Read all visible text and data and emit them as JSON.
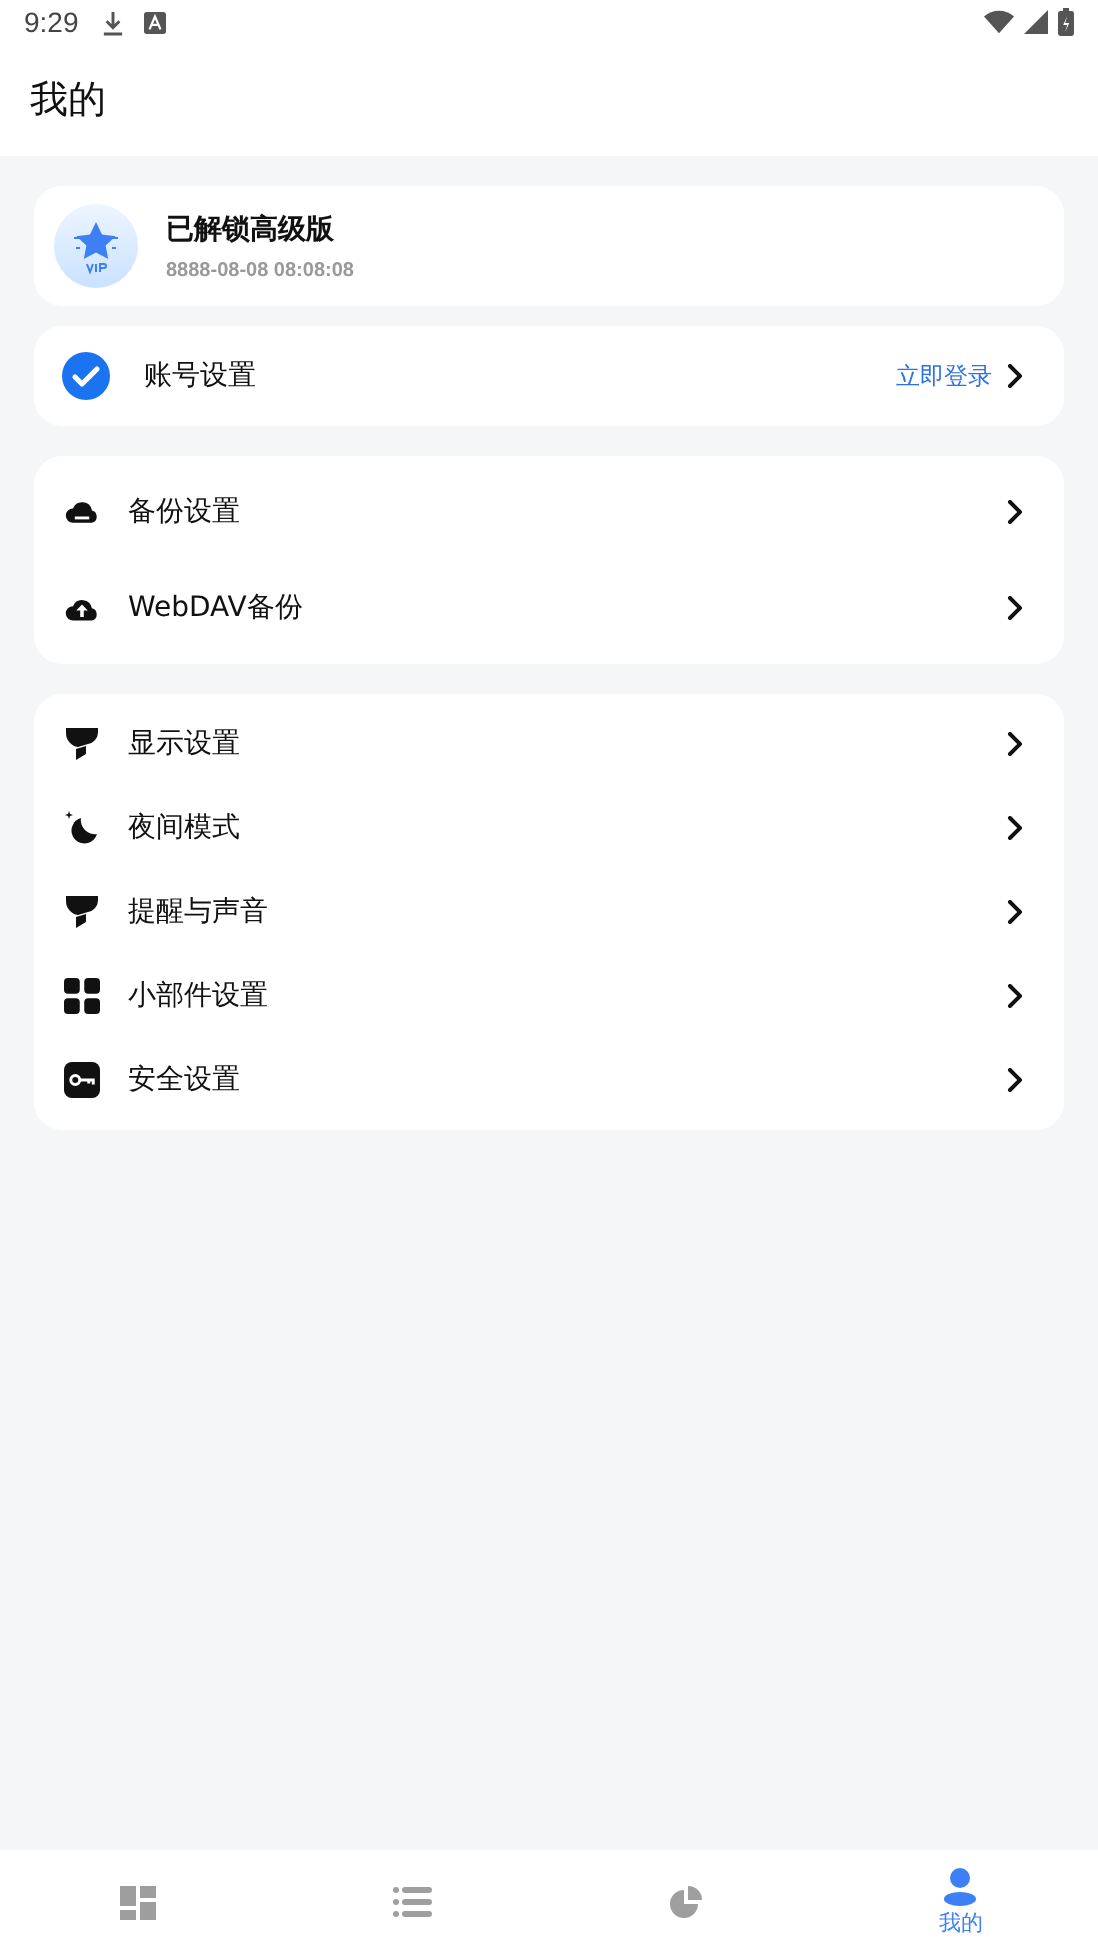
{
  "status_bar": {
    "time": "9:29"
  },
  "header": {
    "title": "我的"
  },
  "vip_card": {
    "title": "已解锁高级版",
    "date": "8888-08-08 08:08:08"
  },
  "account": {
    "label": "账号设置",
    "action": "立即登录"
  },
  "groups": [
    {
      "items": [
        {
          "kind": "cloud",
          "label": "备份设置"
        },
        {
          "kind": "upload",
          "label": "WebDAV备份"
        }
      ]
    },
    {
      "items": [
        {
          "kind": "funnel",
          "label": "显示设置"
        },
        {
          "kind": "moon",
          "label": "夜间模式"
        },
        {
          "kind": "funnel",
          "label": "提醒与声音"
        },
        {
          "kind": "grid",
          "label": "小部件设置"
        },
        {
          "kind": "key",
          "label": "安全设置"
        }
      ]
    }
  ],
  "bottom_nav": [
    {
      "kind": "dashboard",
      "selected": false
    },
    {
      "kind": "list",
      "selected": false
    },
    {
      "kind": "pie",
      "selected": false
    },
    {
      "kind": "person",
      "label": "我的",
      "selected": true
    }
  ]
}
